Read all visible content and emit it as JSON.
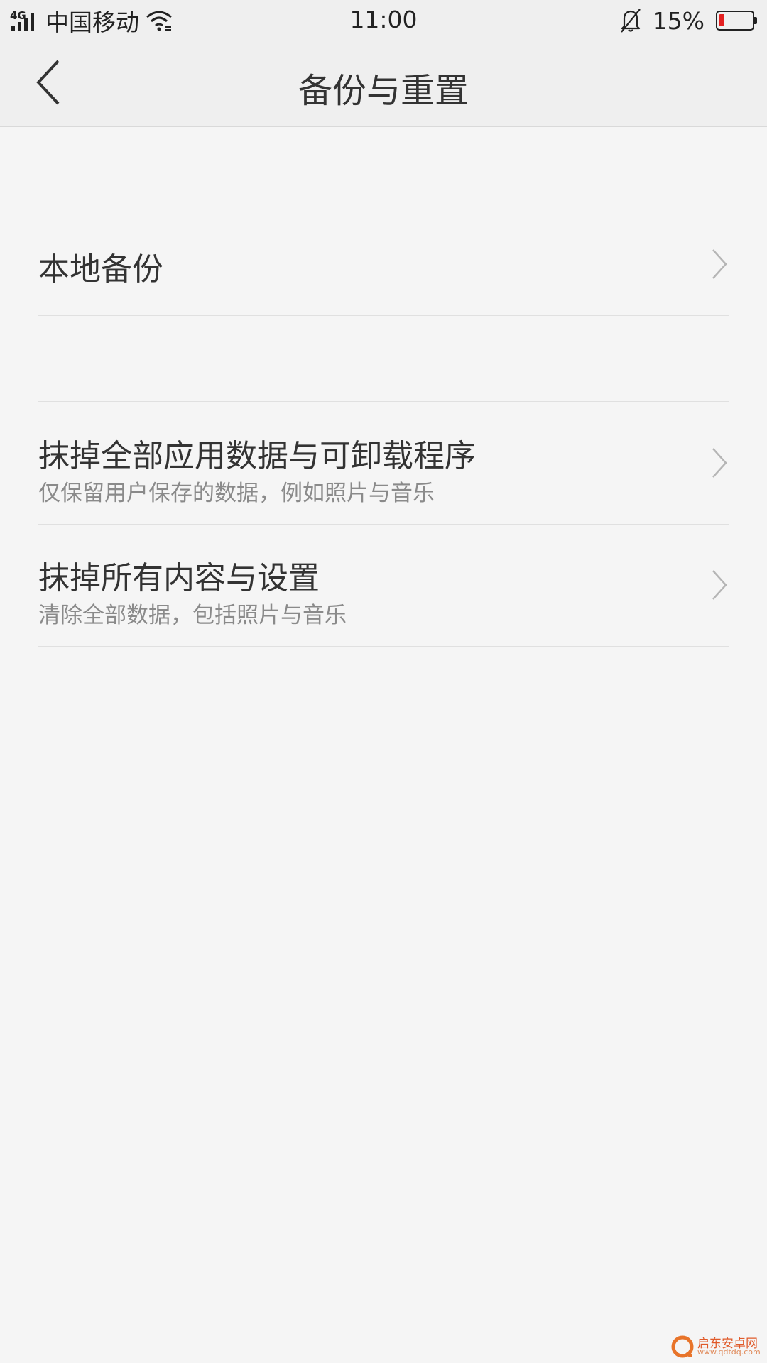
{
  "status_bar": {
    "network_type": "4G",
    "carrier": "中国移动",
    "time": "11:00",
    "battery_percent": "15%",
    "battery_level": 0.15,
    "battery_color": "#e32020",
    "icons": [
      "signal-icon",
      "wifi-icon",
      "bell-muted-icon",
      "battery-icon"
    ]
  },
  "header": {
    "title": "备份与重置",
    "back_icon": "chevron-left-icon"
  },
  "sections": [
    {
      "items": [
        {
          "title": "本地备份",
          "subtitle": ""
        }
      ]
    },
    {
      "items": [
        {
          "title": "抹掉全部应用数据与可卸载程序",
          "subtitle": "仅保留用户保存的数据，例如照片与音乐"
        },
        {
          "title": "抹掉所有内容与设置",
          "subtitle": "清除全部数据，包括照片与音乐"
        }
      ]
    }
  ],
  "watermark": {
    "name": "启东安卓网",
    "url": "www.qdtdq.com"
  }
}
